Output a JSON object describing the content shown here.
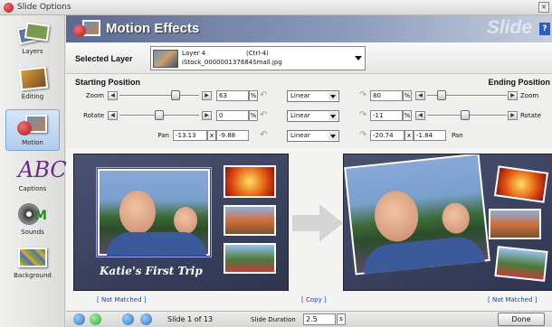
{
  "window": {
    "title": "Slide Options",
    "close_label": "×"
  },
  "sidebar": {
    "items": [
      {
        "label": "Layers"
      },
      {
        "label": "Editing"
      },
      {
        "label": "Motion"
      },
      {
        "label": "Captions"
      },
      {
        "label": "Sounds"
      },
      {
        "label": "Background"
      }
    ],
    "active_index": 2
  },
  "header": {
    "title": "Motion Effects",
    "watermark": "Slide",
    "help_label": "?"
  },
  "layer": {
    "label": "Selected Layer",
    "name": "Layer 4",
    "shortcut": "(Ctrl-4)",
    "file": "iStock_000000137684Small.jpg"
  },
  "starting": {
    "title": "Starting Position",
    "zoom_label": "Zoom",
    "zoom_value": "63",
    "zoom_unit": "%",
    "zoom_curve": "Linear",
    "rotate_label": "Rotate",
    "rotate_value": "0",
    "rotate_unit": "%",
    "rotate_curve": "Linear",
    "pan_label": "Pan",
    "pan_x": "-13.13",
    "pan_sep": "x",
    "pan_y": "-9.88",
    "pan_curve": "Linear"
  },
  "ending": {
    "title": "Ending Position",
    "zoom_label": "Zoom",
    "zoom_value": "80",
    "zoom_unit": "%",
    "rotate_label": "Rotate",
    "rotate_value": "-11",
    "rotate_unit": "%",
    "pan_label": "Pan",
    "pan_x": "-20.74",
    "pan_sep": "x",
    "pan_y": "-1.84"
  },
  "preview": {
    "caption": "Katie's First Trip",
    "left_link": "[ Not Matched ]",
    "copy_link": "[ Copy ]",
    "right_link": "[ Not Matched ]"
  },
  "footer": {
    "slide_counter": "Slide 1 of 13",
    "duration_label": "Slide Duration",
    "duration_value": "2.5",
    "duration_unit": "s",
    "done_label": "Done"
  },
  "colors": {
    "header_bg": "#5a6a90",
    "link": "#1a3fa8",
    "frame_bg": "#3a4260"
  }
}
